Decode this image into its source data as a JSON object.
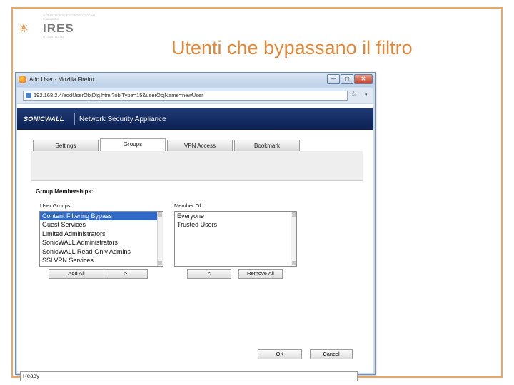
{
  "logo": {
    "brand": "IRES",
    "line1": "ISTITUTO RICERCHE ECONOMICO SOCIALI",
    "line2": "FONDAZIONE",
    "line3": "ISTITUTO SOCIAL"
  },
  "slide": {
    "title": "Utenti che bypassano il filtro"
  },
  "window": {
    "title": "Add User - Mozilla Firefox",
    "buttons": {
      "minimize": "—",
      "maximize": "▢",
      "close": "✕"
    }
  },
  "browser": {
    "url": "192.168.2.4/addUserObjDlg.html?objType=15&userObjName=newUser",
    "bookmark_icon": "☆",
    "dropdown_icon": "▾"
  },
  "app": {
    "brand": "SONICWALL",
    "product": "Network Security Appliance",
    "tabs": [
      {
        "label": "Settings",
        "active": false
      },
      {
        "label": "Groups",
        "active": true
      },
      {
        "label": "VPN Access",
        "active": false
      },
      {
        "label": "Bookmark",
        "active": false
      }
    ],
    "group_heading": "Group Memberships:",
    "user_groups_label": "User Groups:",
    "member_of_label": "Member Of:",
    "user_groups": [
      {
        "label": "Content Filtering Bypass",
        "selected": true
      },
      {
        "label": "Guest Services",
        "selected": false
      },
      {
        "label": "Limited Administrators",
        "selected": false
      },
      {
        "label": "SonicWALL Administrators",
        "selected": false
      },
      {
        "label": "SonicWALL Read-Only Admins",
        "selected": false
      },
      {
        "label": "SSLVPN Services",
        "selected": false
      }
    ],
    "member_of": [
      "Everyone",
      "Trusted Users"
    ],
    "buttons": {
      "add_all": "Add All",
      "move_right": ">",
      "move_left": "<",
      "remove_all": "Remove All",
      "ok": "OK",
      "cancel": "Cancel"
    },
    "status": "Ready"
  },
  "colors": {
    "frame": "#e3a86a",
    "title": "#e1893a",
    "banner": "#0c2152",
    "selection": "#3169c6"
  }
}
